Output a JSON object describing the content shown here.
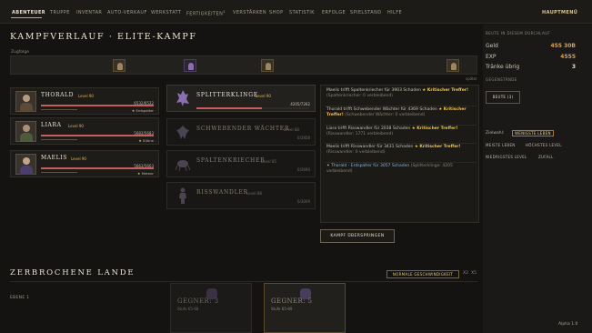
{
  "nav": {
    "tabs": [
      "ABENTEUER",
      "TRUPPE",
      "INVENTAR",
      "AUTO-VERKAUF",
      "WERKSTATT",
      "FERTIGKEITEN",
      "VERSTÄRKEN",
      "SHOP",
      "STATISTIK",
      "ERFOLGE",
      "SPIELSTAND",
      "HILFE"
    ],
    "skills_badge": "1",
    "home": "HAUPTMENÜ"
  },
  "battle": {
    "title": "KAMPFVERLAUF · ELITE-KAMPF",
    "turn_order_label": "Zugfolge",
    "later_label": "später",
    "skip_button": "KAMPF ÜBERSPRINGEN"
  },
  "heroes": [
    {
      "name": "THORALD",
      "level": "Level 90",
      "hp": "6532/6532",
      "hp_fraction": 1.0,
      "tag": "Erdspalter",
      "tag_icon": "★",
      "skin": "#b39c80",
      "armor": "#5c4a36"
    },
    {
      "name": "LIARA",
      "level": "Level 90",
      "hp": "5683/5683",
      "hp_fraction": 1.0,
      "tag": "Sühne",
      "tag_icon": "★",
      "skin": "#a78f76",
      "armor": "#4d5a3c"
    },
    {
      "name": "MAELIS",
      "level": "Level 90",
      "hp": "5663/5663",
      "hp_fraction": 1.0,
      "tag": "Meteor",
      "tag_icon": "★",
      "skin": "#c2a58a",
      "armor": "#4a3e6a"
    }
  ],
  "enemies": [
    {
      "name": "SPLITTERKLINGE",
      "level": "Level 90",
      "hp": "4205/7262",
      "hp_fraction": 0.58,
      "active": true
    },
    {
      "name": "SCHWEBENDER WÄCHTER",
      "level": "Level 88",
      "hp": "0/2858",
      "hp_fraction": 0,
      "active": false
    },
    {
      "name": "SPALTENKRIECHER",
      "level": "Level 85",
      "hp": "0/2690",
      "hp_fraction": 0,
      "active": false
    },
    {
      "name": "RISSWANDLER",
      "level": "Level 88",
      "hp": "0/3009",
      "hp_fraction": 0,
      "active": false
    }
  ],
  "log": [
    {
      "line1": "Maelis trifft Spaltenkriecher für 3903 Schaden",
      "crit": "★ Kritischer Treffer!",
      "sub": "(Spaltenkriecher: 0 verbleibend)"
    },
    {
      "line1": "Thorald trifft Schwebender Wächter für 4369 Schaden",
      "crit": "★ Kritischer Treffer!",
      "sub": "(Schwebender Wächter: 0 verbleibend)"
    },
    {
      "line1": "Liara trifft Risswandler für 2038 Schaden",
      "crit": "★ Kritischer Treffer!",
      "sub": "(Risswandler: 1771 verbleibend)"
    },
    {
      "line1": "Maelis trifft Risswandler für 3431 Schaden",
      "crit": "★ Kritischer Treffer!",
      "sub": "(Risswandler: 0 verbleibend)"
    },
    {
      "line1": "✦ Thorald - Erdspalter für 3057 Schaden",
      "crit": "",
      "sub": "(Splitterklinge: 4205 verbleibend)"
    }
  ],
  "side": {
    "loot_header": "BEUTE IN DIESEM DURCHLAUF",
    "gold_label": "Geld",
    "gold_value": "455 30B",
    "exp_label": "EXP",
    "exp_value": "4555",
    "potions_label": "Tränke übrig",
    "potions_value": "3",
    "items_header": "GEGENSTÄNDE",
    "loot_button": "BEUTE (3)",
    "target_label": "Zielwahl:",
    "target_options": [
      "WENIGSTE LEBEN",
      "MEISTE LEBEN",
      "HÖCHSTES LEVEL",
      "NIEDRIGSTES LEVEL",
      "ZUFALL"
    ]
  },
  "area": {
    "title": "ZERBROCHENE LANDE",
    "speed_button": "NORMALE GESCHWINDIGKEIT",
    "speed_x2": "X2",
    "speed_x5": "X5",
    "level_label": "EBENE 1",
    "cards": [
      {
        "name": "GEGNER: 3",
        "stage": "Stufe 65-68"
      },
      {
        "name": "GEGNER: 5",
        "stage": "Stufe 65-69"
      }
    ]
  },
  "version": "Alpha 1.0",
  "colors": {
    "accent": "#d7a34a",
    "crit": "#f0c552",
    "hp": "#c85d5d",
    "gold": "#e0b65b",
    "exp": "#e2a042"
  }
}
